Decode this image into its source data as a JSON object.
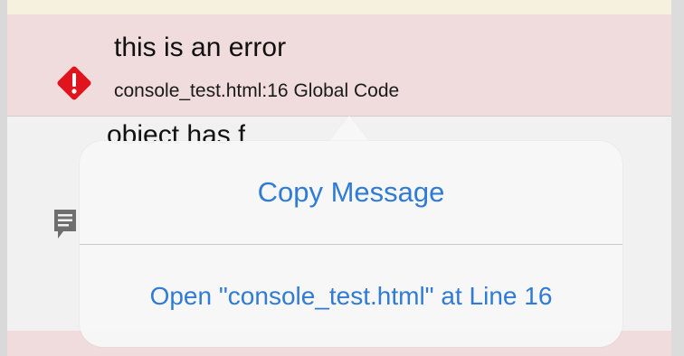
{
  "console": {
    "error_message": {
      "title": "this is an error",
      "source": "console_test.html:16 Global Code",
      "icon": "error-diamond-icon",
      "icon_color": "#e0141c",
      "row_color": "#f0dcdc"
    },
    "next_message": {
      "partial_text": "object has f",
      "icon": "log-message-icon"
    }
  },
  "context_menu": {
    "copy_label": "Copy Message",
    "open_label": "Open \"console_test.html\" at Line 16",
    "accent_color": "#2f7bd6"
  }
}
